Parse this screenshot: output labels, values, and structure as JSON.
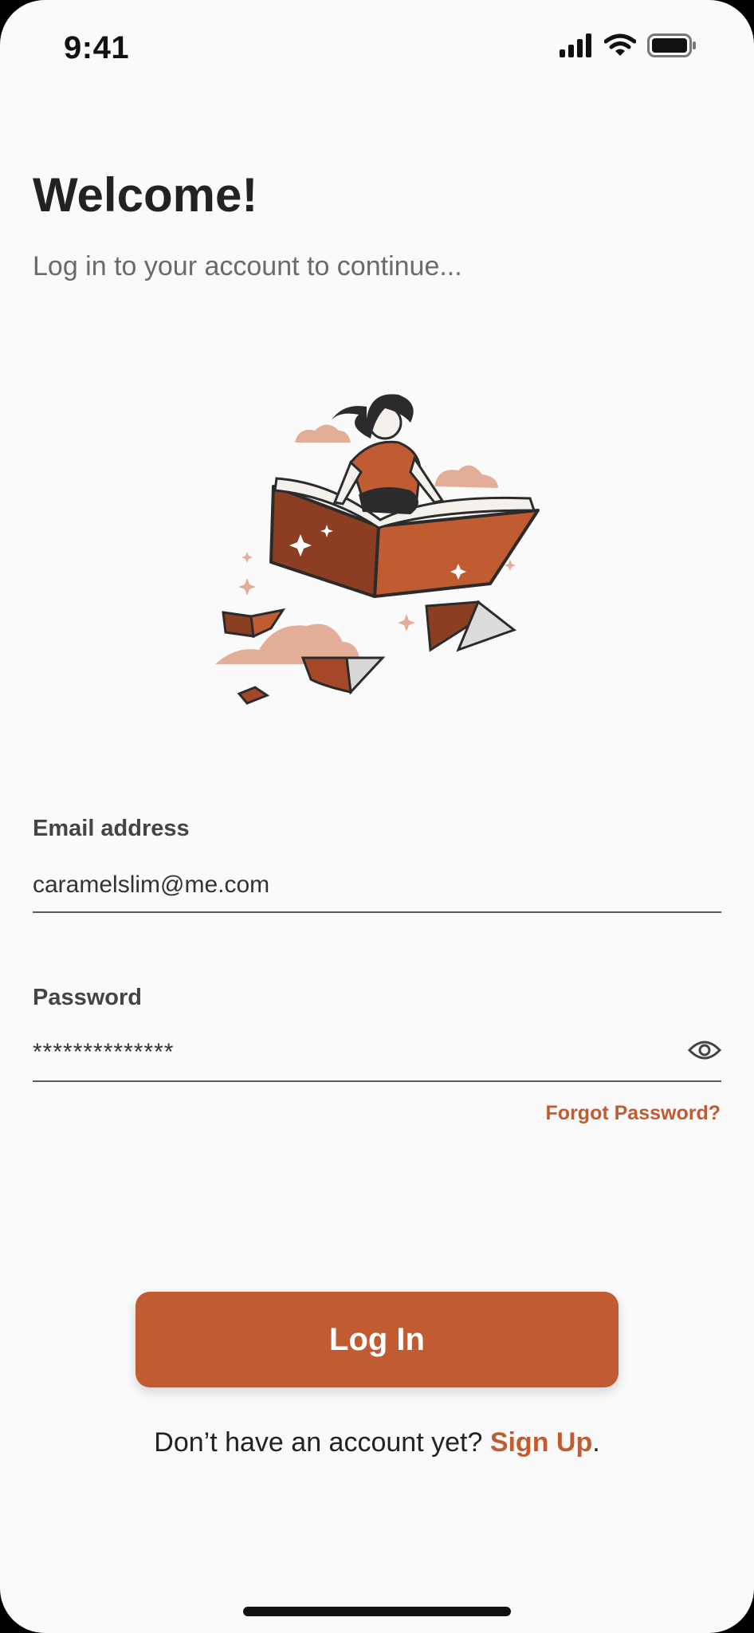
{
  "status_bar": {
    "time": "9:41"
  },
  "header": {
    "title": "Welcome!",
    "subtitle": "Log in to your account to continue..."
  },
  "illustration": {
    "name": "reader-flying-on-book"
  },
  "form": {
    "email": {
      "label": "Email address",
      "value": "caramelslim@me.com"
    },
    "password": {
      "label": "Password",
      "value": "**************",
      "toggle_icon": "eye-icon"
    },
    "forgot_label": "Forgot Password?"
  },
  "actions": {
    "login_label": "Log In",
    "signup_prompt": "Don’t have an account yet?",
    "signup_label": "Sign Up",
    "signup_suffix": "."
  },
  "colors": {
    "accent": "#c05b32",
    "background": "#fafafa",
    "cloud": "#e3ae98"
  }
}
